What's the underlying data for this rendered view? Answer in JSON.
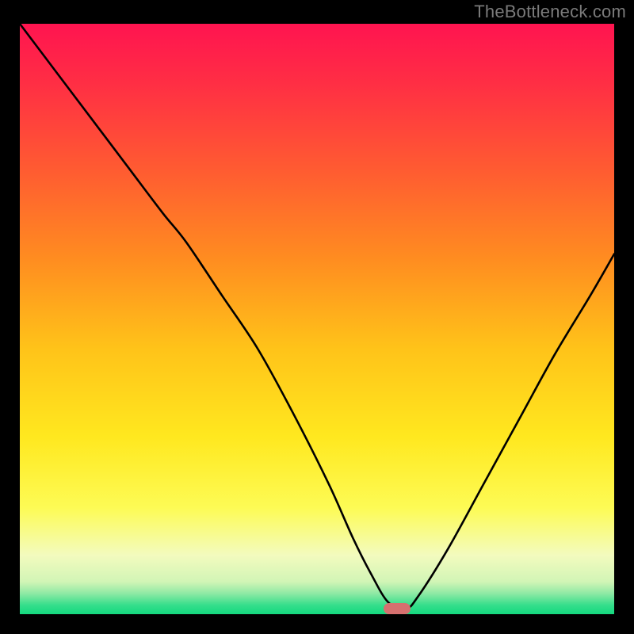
{
  "watermark": "TheBottleneck.com",
  "colors": {
    "background": "#000000",
    "curve": "#000000",
    "marker": "#d6706f",
    "gradient_stops": [
      {
        "offset": 0.0,
        "color": "#ff1450"
      },
      {
        "offset": 0.1,
        "color": "#ff2e44"
      },
      {
        "offset": 0.25,
        "color": "#ff5c31"
      },
      {
        "offset": 0.4,
        "color": "#ff8d20"
      },
      {
        "offset": 0.55,
        "color": "#ffc319"
      },
      {
        "offset": 0.7,
        "color": "#ffe81f"
      },
      {
        "offset": 0.82,
        "color": "#fdfb55"
      },
      {
        "offset": 0.9,
        "color": "#f3fbbe"
      },
      {
        "offset": 0.945,
        "color": "#d2f5b6"
      },
      {
        "offset": 0.965,
        "color": "#8ee9a4"
      },
      {
        "offset": 0.985,
        "color": "#34de8b"
      },
      {
        "offset": 1.0,
        "color": "#14d97f"
      }
    ]
  },
  "chart_data": {
    "type": "line",
    "title": "",
    "xlabel": "",
    "ylabel": "",
    "xlim": [
      0,
      100
    ],
    "ylim": [
      0,
      100
    ],
    "grid": false,
    "legend": false,
    "series": [
      {
        "name": "bottleneck-curve",
        "x": [
          0,
          6,
          12,
          18,
          24,
          28,
          34,
          40,
          46,
          52,
          56,
          59,
          62,
          65,
          67,
          72,
          78,
          84,
          90,
          96,
          100
        ],
        "y": [
          100,
          92,
          84,
          76,
          68,
          63,
          54,
          45,
          34,
          22,
          13,
          7,
          2,
          1,
          3,
          11,
          22,
          33,
          44,
          54,
          61
        ]
      }
    ],
    "marker": {
      "x": 63.5,
      "y": 1
    }
  }
}
